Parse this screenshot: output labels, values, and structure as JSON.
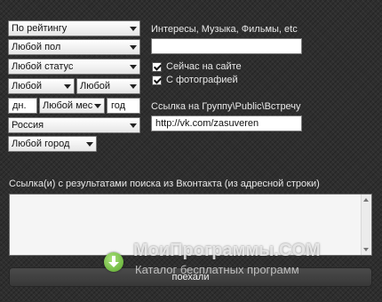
{
  "filters": {
    "sort": "По рейтингу",
    "gender": "Любой пол",
    "status": "Любой статус",
    "age_from": "Любой",
    "age_to": "Любой",
    "birth_day": "дн.",
    "birth_month": "Любой мес",
    "birth_year": "год",
    "country": "Россия",
    "city": "Любой город"
  },
  "interests": {
    "label": "Интересы, Музыка, Фильмы, etc",
    "value": ""
  },
  "checkboxes": {
    "online_label": "Сейчас на сайте",
    "online_checked": true,
    "photo_label": "С фотографией",
    "photo_checked": true
  },
  "group": {
    "label": "Ссылка на Группу\\Public\\Встречу",
    "value": "http://vk.com/zasuveren"
  },
  "results": {
    "label": "Ссылка(и) с результатами поиска из Вконтакта (из адресной строки)",
    "value": ""
  },
  "search_button": "поехали",
  "watermark": {
    "title": "МоиПрограммы.COM",
    "subtitle": "Каталог бесплатных программ"
  }
}
